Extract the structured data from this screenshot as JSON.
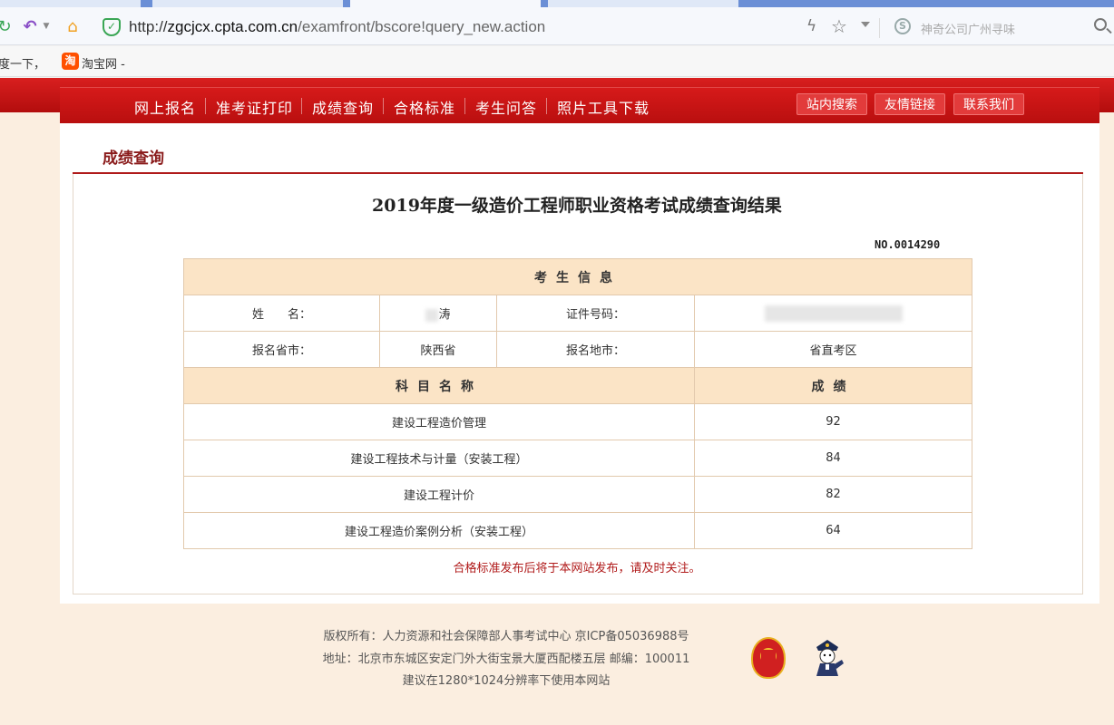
{
  "browser": {
    "url": {
      "scheme": "http://",
      "host": "zgcjcx.cpta.com.cn",
      "path": "/examfront/bscore!query_new.action"
    },
    "search_placeholder": "神奇公司广州寻味",
    "bookmarks": [
      {
        "label": "度一下，"
      },
      {
        "label": "淘宝网 -"
      }
    ],
    "taobao_logo_char": "淘"
  },
  "nav": {
    "items": [
      "网上报名",
      "准考证打印",
      "成绩查询",
      "合格标准",
      "考生问答",
      "照片工具下载"
    ],
    "buttons": [
      "站内搜索",
      "友情链接",
      "联系我们"
    ]
  },
  "page": {
    "section_title": "成绩查询",
    "main_title": "2019年度一级造价工程师职业资格考试成绩查询结果",
    "cert_no": "NO.0014290",
    "candidate_header": "考生信息",
    "labels": {
      "name": "姓　　名：",
      "id_number": "证件号码：",
      "province": "报名省市：",
      "city": "报名地市："
    },
    "values": {
      "name_visible": "涛",
      "province": "陕西省",
      "city": "省直考区"
    },
    "subject_header": "科目名称",
    "score_header": "成绩",
    "subjects": [
      {
        "name": "建设工程造价管理",
        "score": "92"
      },
      {
        "name": "建设工程技术与计量（安装工程）",
        "score": "84"
      },
      {
        "name": "建设工程计价",
        "score": "82"
      },
      {
        "name": "建设工程造价案例分析（安装工程）",
        "score": "64"
      }
    ],
    "note": "合格标准发布后将于本网站发布，请及时关注。"
  },
  "footer": {
    "copyright": "版权所有：人力资源和社会保障部人事考试中心 京ICP备05036988号",
    "address": "地址：北京市东城区安定门外大街宝景大厦西配楼五层 邮编：100011",
    "resolution": "建议在1280*1024分辨率下使用本网站"
  },
  "colors": {
    "brand_red": "#c41616",
    "table_header_bg": "#fbe4c6",
    "note_red": "#b01a1a"
  }
}
